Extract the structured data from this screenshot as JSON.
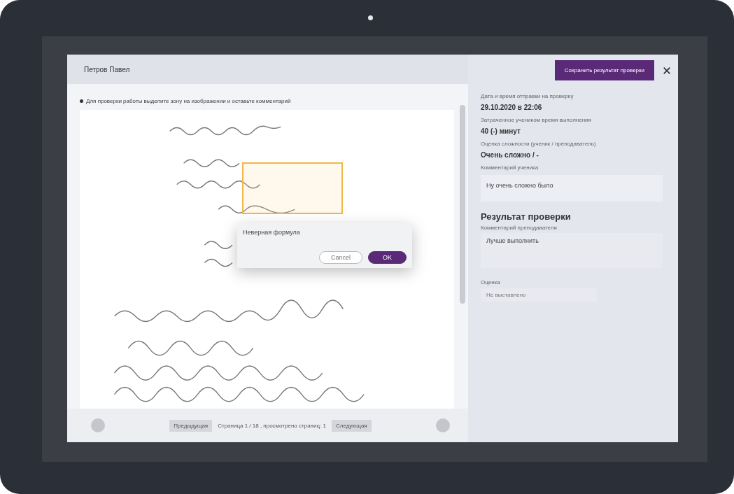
{
  "viewer": {
    "student_name": "Петров Павел",
    "hint": "Для проверки работы выделите зону на изображении и оставьте комментарий",
    "annotation": {
      "comment": "Неверная формула",
      "buttons": [
        {
          "label": "Cancel",
          "kind": "secondary"
        },
        {
          "label": "OK",
          "kind": "primary"
        }
      ]
    },
    "pager": {
      "previous": "Предыдущая",
      "status": "Страница 1 / 18 , просмотрено страниц: 1",
      "next": "Следующая"
    }
  },
  "details": {
    "save_button": "Сохранить результат проверки",
    "fields": [
      {
        "label": "Дата и время отправки на проверку",
        "value": "29.10.2020 в 22:06",
        "kind": "text"
      },
      {
        "label": "Затраченное учеником время выполнения",
        "value": "40 (-) минут",
        "kind": "text"
      },
      {
        "label": "Оценка сложности (ученик / преподаватель)",
        "value": "Очень сложно / -",
        "kind": "text"
      },
      {
        "label": "Комментарий ученика",
        "value": "Ну очень сложно было",
        "kind": "box"
      }
    ],
    "result": {
      "heading": "Результат проверки",
      "teacher_comment": {
        "label": "Комментарий преподавателя",
        "value": "Лучше выполнить"
      },
      "grade": {
        "label": "Оценка",
        "placeholder": "Не выставлено"
      }
    }
  }
}
